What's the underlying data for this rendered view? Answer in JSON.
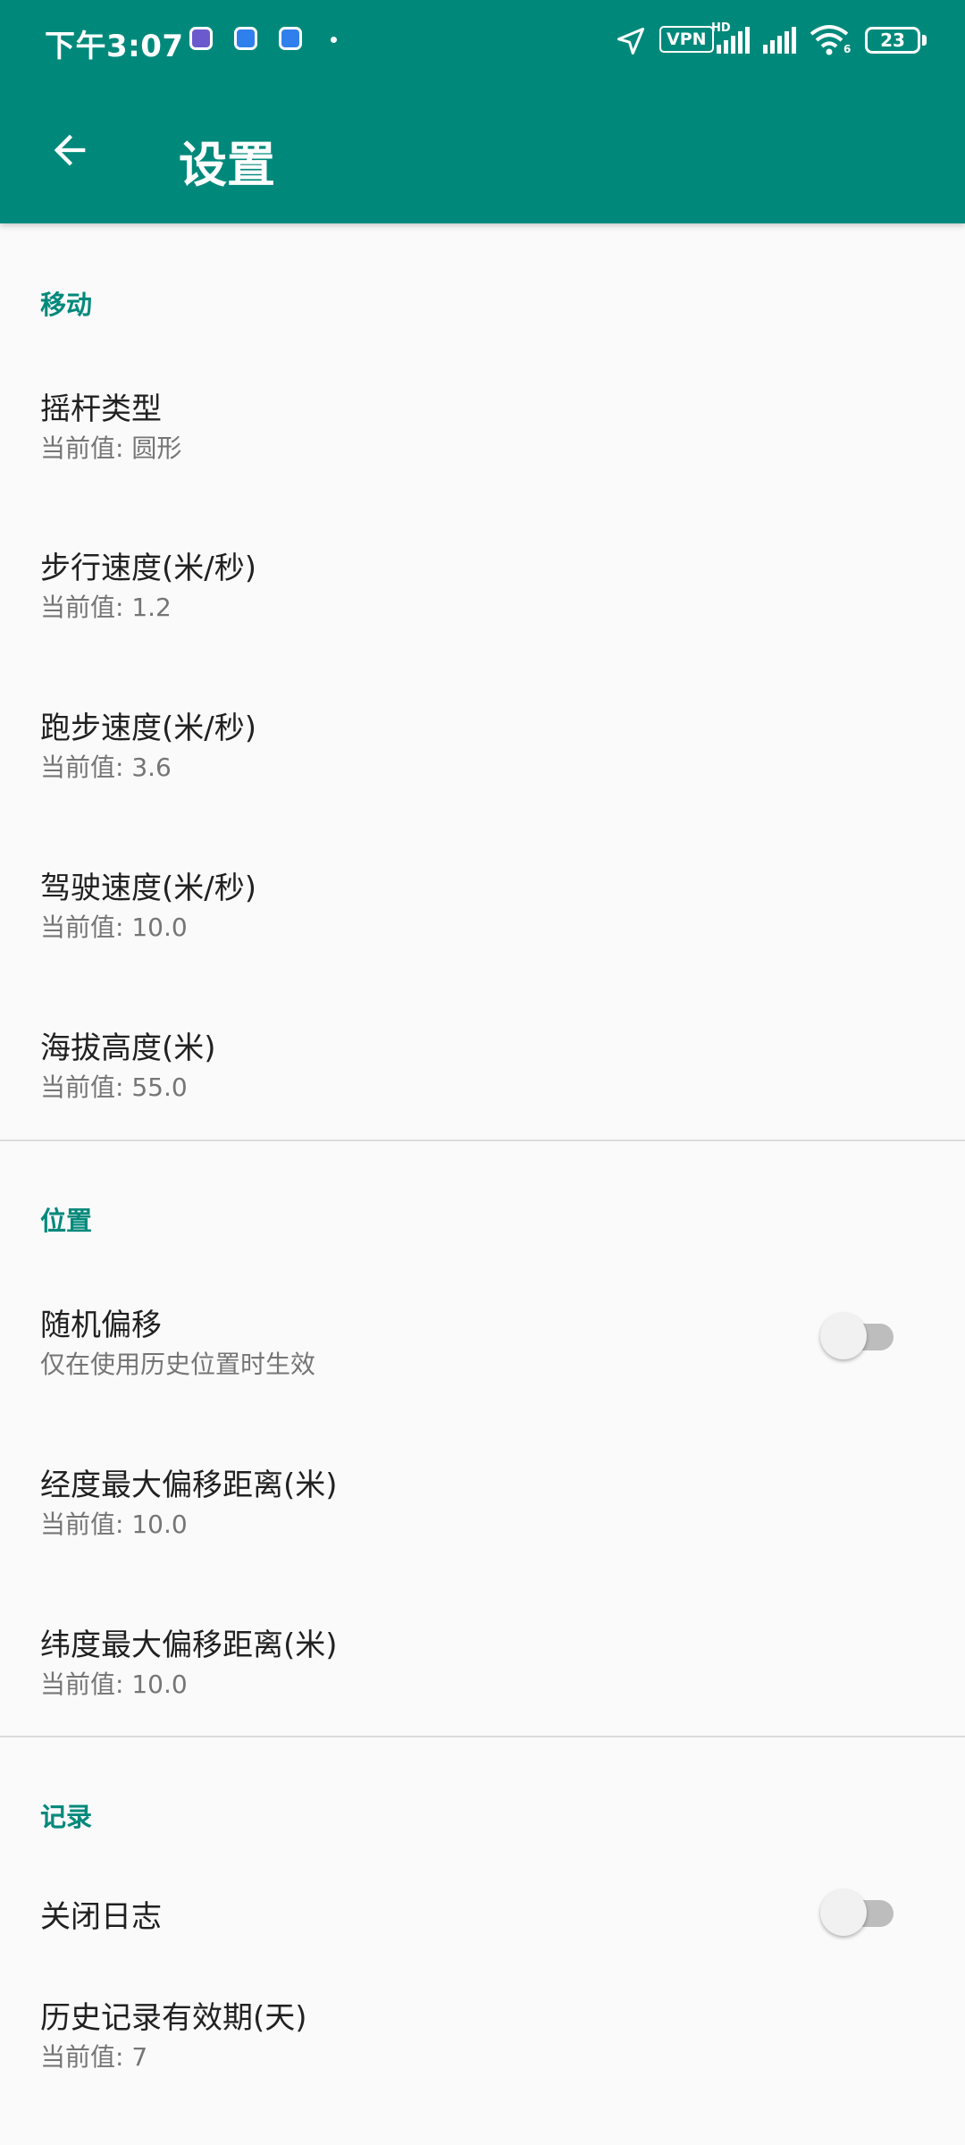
{
  "status_bar": {
    "time": "下午3:07",
    "vpn": "VPN",
    "network_label": "HD",
    "wifi_label": "6",
    "battery": "23"
  },
  "app_bar": {
    "title": "设置",
    "back_icon": "arrow-left-icon",
    "color": "#00897b"
  },
  "sections": {
    "move": {
      "header": "移动",
      "items": [
        {
          "title": "摇杆类型",
          "summary": "当前值: 圆形"
        },
        {
          "title": "步行速度(米/秒)",
          "summary": "当前值: 1.2"
        },
        {
          "title": "跑步速度(米/秒)",
          "summary": "当前值: 3.6"
        },
        {
          "title": "驾驶速度(米/秒)",
          "summary": "当前值: 10.0"
        },
        {
          "title": "海拔高度(米)",
          "summary": "当前值: 55.0"
        }
      ]
    },
    "location": {
      "header": "位置",
      "items": [
        {
          "title": "随机偏移",
          "summary": "仅在使用历史位置时生效",
          "switch_on": false
        },
        {
          "title": "经度最大偏移距离(米)",
          "summary": "当前值: 10.0"
        },
        {
          "title": "纬度最大偏移距离(米)",
          "summary": "当前值: 10.0"
        }
      ]
    },
    "record": {
      "header": "记录",
      "items": [
        {
          "title": "关闭日志",
          "switch_on": false
        },
        {
          "title": "历史记录有效期(天)",
          "summary": "当前值: 7"
        }
      ]
    }
  },
  "colors": {
    "accent": "#00897b",
    "background": "#fafafa",
    "title_text": "#212121",
    "summary_text": "#757575"
  }
}
